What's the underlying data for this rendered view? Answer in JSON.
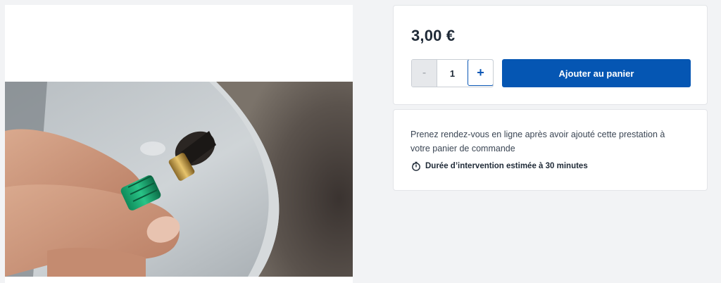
{
  "product": {
    "image_alt": "Tire valve cap being screwed on",
    "price": "3,00 €"
  },
  "quantity": {
    "minus_label": "-",
    "value": "1",
    "plus_label": "+"
  },
  "cart": {
    "add_button_label": "Ajouter au panier"
  },
  "info": {
    "text": "Prenez rendez-vous en ligne après avoir ajouté cette prestation à votre panier de commande",
    "duration_icon": "stopwatch-icon",
    "duration_text": "Durée d’intervention estimée à 30 minutes"
  },
  "colors": {
    "accent": "#0556b3",
    "background": "#f2f3f5",
    "card": "#ffffff"
  }
}
